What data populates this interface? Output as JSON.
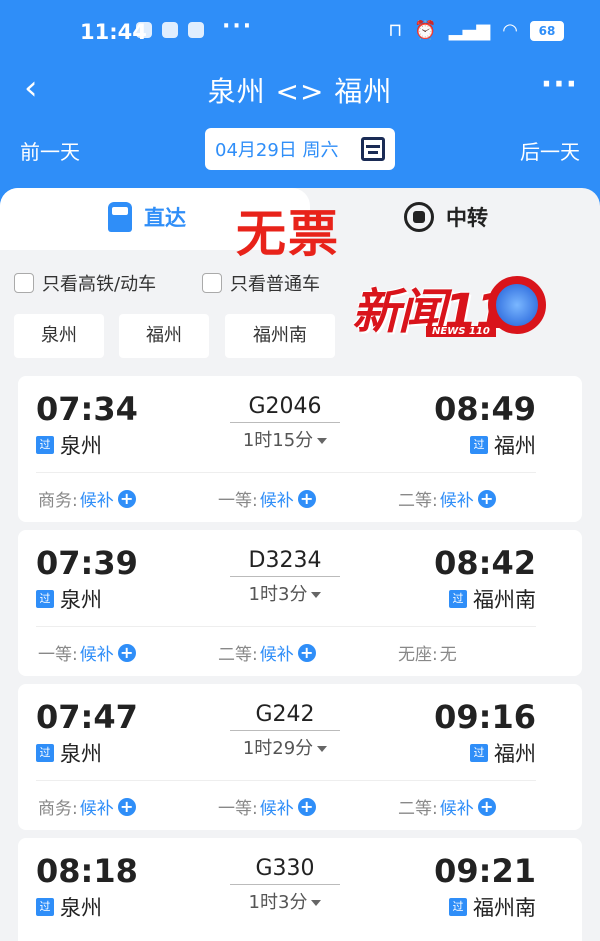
{
  "status_bar": {
    "time": "11:44",
    "dots": "···",
    "battery": "68"
  },
  "nav": {
    "back_symbol": "‹",
    "title": "泉州 <> 福州",
    "more_symbol": "···"
  },
  "dates": {
    "prev": "前一天",
    "current": "04月29日 周六",
    "next": "后一天"
  },
  "tabs": {
    "direct": "直达",
    "transfer": "中转"
  },
  "stamp_text": "无票",
  "filters": {
    "high_speed": "只看高铁/动车",
    "normal": "只看普通车"
  },
  "stations": [
    "泉州",
    "福州",
    "福州南"
  ],
  "logo": {
    "main": "新闻110",
    "sub": "NEWS 110"
  },
  "badge_text": "过",
  "trains": [
    {
      "dep_time": "07:34",
      "dep_station": "泉州",
      "train_no": "G2046",
      "duration": "1时15分",
      "arr_time": "08:49",
      "arr_station": "福州",
      "seats": [
        {
          "label": "商务:",
          "value": "候补",
          "plus": true
        },
        {
          "label": "一等:",
          "value": "候补",
          "plus": true
        },
        {
          "label": "二等:",
          "value": "候补",
          "plus": true
        }
      ]
    },
    {
      "dep_time": "07:39",
      "dep_station": "泉州",
      "train_no": "D3234",
      "duration": "1时3分",
      "arr_time": "08:42",
      "arr_station": "福州南",
      "seats": [
        {
          "label": "一等:",
          "value": "候补",
          "plus": true
        },
        {
          "label": "二等:",
          "value": "候补",
          "plus": true
        },
        {
          "label": "无座:",
          "value": "无",
          "plus": false
        }
      ]
    },
    {
      "dep_time": "07:47",
      "dep_station": "泉州",
      "train_no": "G242",
      "duration": "1时29分",
      "arr_time": "09:16",
      "arr_station": "福州",
      "seats": [
        {
          "label": "商务:",
          "value": "候补",
          "plus": true
        },
        {
          "label": "一等:",
          "value": "候补",
          "plus": true
        },
        {
          "label": "二等:",
          "value": "候补",
          "plus": true
        }
      ]
    },
    {
      "dep_time": "08:18",
      "dep_station": "泉州",
      "train_no": "G330",
      "duration": "1时3分",
      "arr_time": "09:21",
      "arr_station": "福州南",
      "seats": []
    }
  ],
  "colors": {
    "primary": "#2f8ef8",
    "stamp": "#e8231a",
    "logo_red": "#d9141b"
  }
}
